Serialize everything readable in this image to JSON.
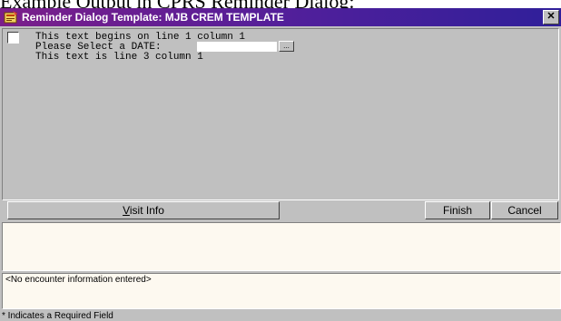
{
  "caption": "Example Output in CPRS Reminder Dialog:",
  "window": {
    "title": "Reminder Dialog Template: MJB CREM TEMPLATE",
    "close_glyph": "✕"
  },
  "editor": {
    "line1": "This text begins on line 1 column 1",
    "line2_label": "Please Select a DATE:",
    "date_value": "",
    "date_button_glyph": "...",
    "line3": "This text is line 3 column 1"
  },
  "buttons": {
    "visit_info_accel": "V",
    "visit_info_rest": "isit Info",
    "finish": "Finish",
    "cancel": "Cancel"
  },
  "encounter": {
    "text": "<No encounter information entered>"
  },
  "status": {
    "text": "* Indicates a Required Field"
  },
  "colors": {
    "titlebar_start": "#7b1e8a",
    "titlebar_end": "#2f1f9a",
    "face": "#c0c0c0",
    "panel": "#fdf9f0"
  },
  "icons": {
    "app": "reminder-dialog-icon",
    "close": "close-icon"
  }
}
